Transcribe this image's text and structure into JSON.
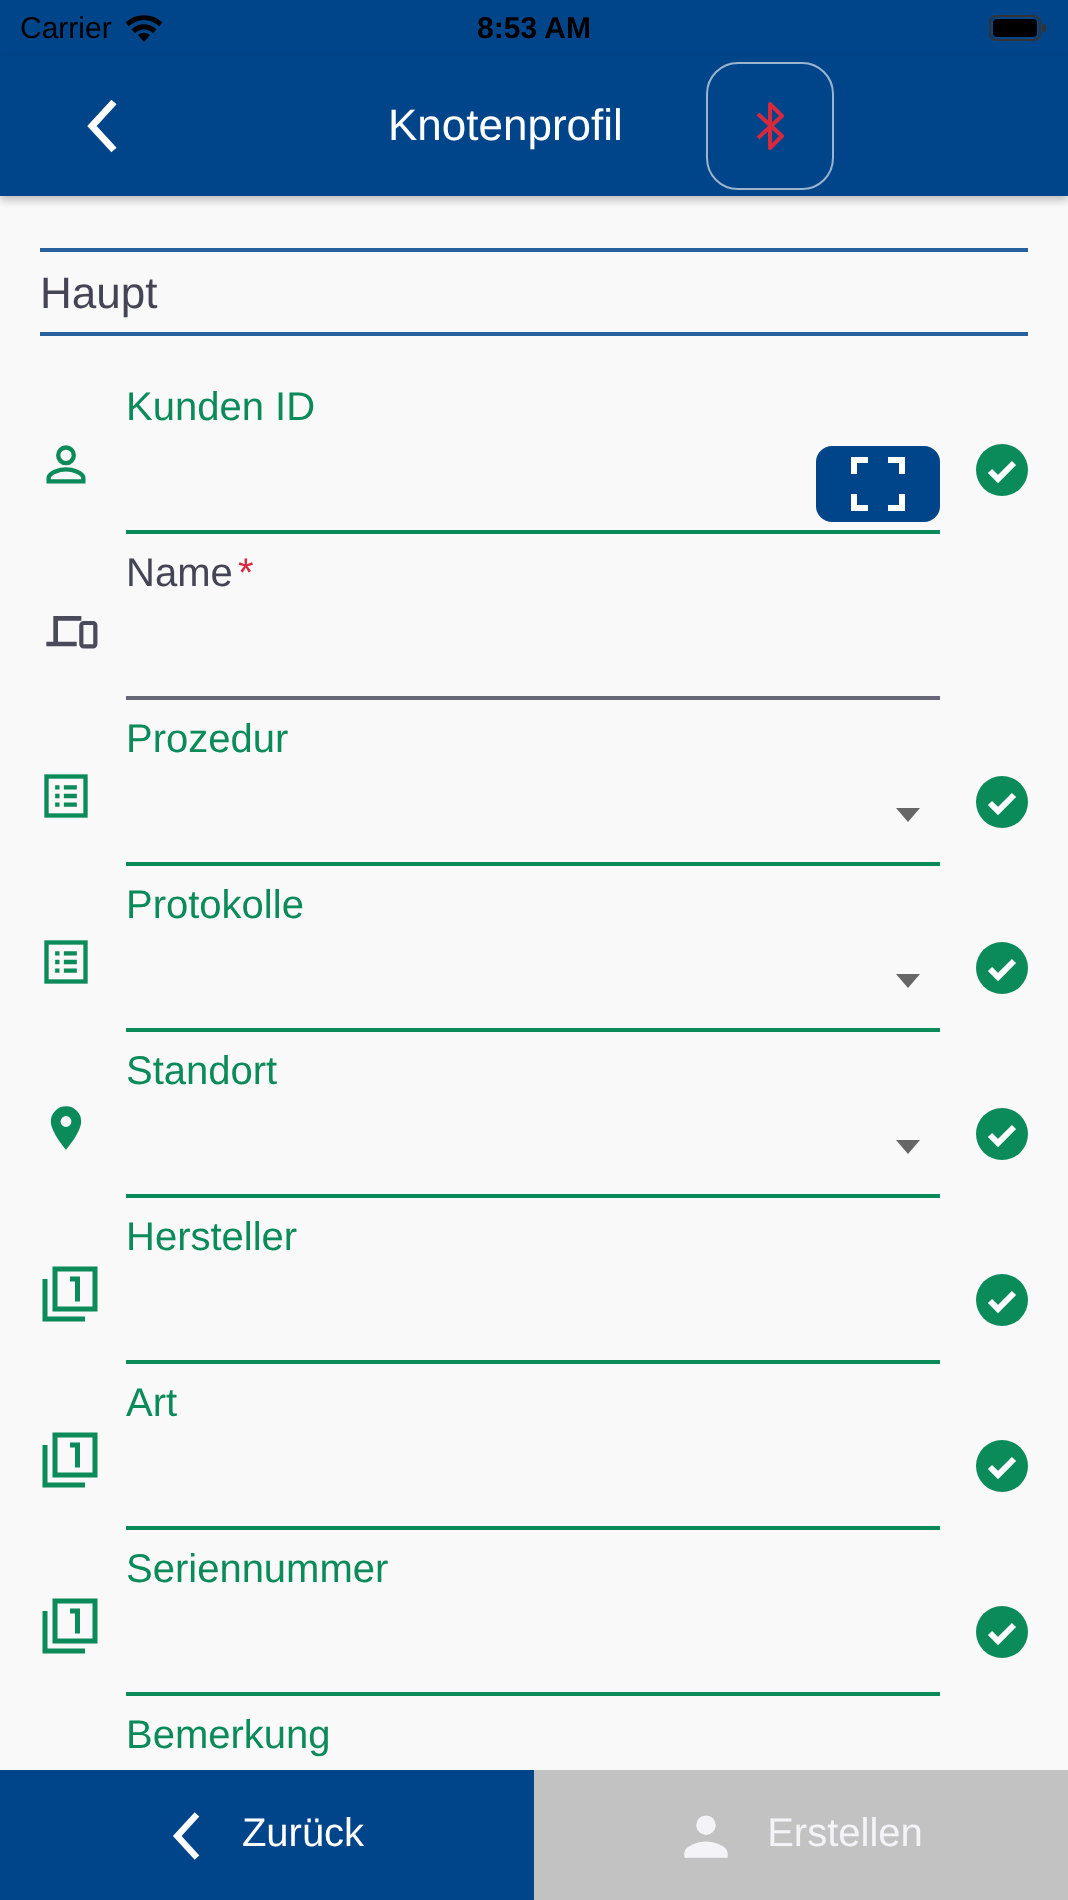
{
  "status_bar": {
    "carrier": "Carrier",
    "time": "8:53 AM"
  },
  "header": {
    "title": "Knotenprofil",
    "bluetooth_connected": false
  },
  "section": {
    "title": "Haupt"
  },
  "fields": [
    {
      "label": "Kunden ID",
      "kind": "scan",
      "valid": true
    },
    {
      "label": "Name",
      "kind": "text",
      "valid": false,
      "required_mark": "*"
    },
    {
      "label": "Prozedur",
      "kind": "dropdown",
      "valid": true
    },
    {
      "label": "Protokolle",
      "kind": "dropdown",
      "valid": true
    },
    {
      "label": "Standort",
      "kind": "dropdown",
      "valid": true
    },
    {
      "label": "Hersteller",
      "kind": "text",
      "valid": true
    },
    {
      "label": "Art",
      "kind": "text",
      "valid": true
    },
    {
      "label": "Seriennummer",
      "kind": "text",
      "valid": true
    },
    {
      "label": "Bemerkung",
      "kind": "text",
      "valid": true,
      "cut_off": true
    }
  ],
  "footer": {
    "back": {
      "label": "Zurück",
      "disabled": false
    },
    "create": {
      "label": "Erstellen",
      "disabled": true
    }
  }
}
